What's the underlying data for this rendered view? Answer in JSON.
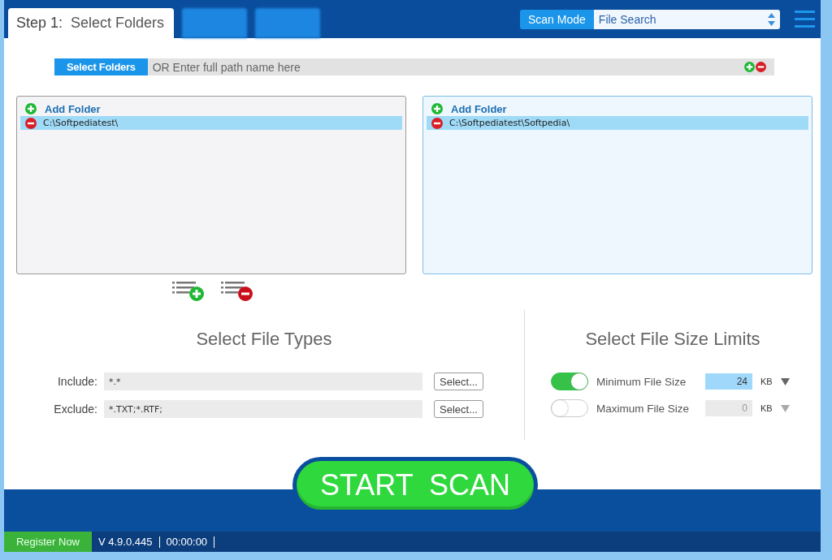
{
  "tabs": [
    {
      "label": "Step 1:",
      "title": "Select Folders",
      "selected": true
    },
    {
      "selected": false
    },
    {
      "selected": false
    }
  ],
  "scan_mode": {
    "label": "Scan Mode",
    "value": "File Search"
  },
  "path_bar": {
    "button": "Select Folders",
    "placeholder": "OR Enter full path name here"
  },
  "folder_panels": [
    {
      "focused": false,
      "add_label": "Add Folder",
      "folders": [
        {
          "path": "C:\\Softpediatest\\",
          "selected": true
        }
      ]
    },
    {
      "focused": true,
      "add_label": "Add Folder",
      "folders": [
        {
          "path": "C:\\Softpediatest\\Softpedia\\",
          "selected": true
        }
      ]
    }
  ],
  "file_types": {
    "title": "Select File Types",
    "rows": [
      {
        "label": "Include:",
        "value": "*.*",
        "button": "Select..."
      },
      {
        "label": "Exclude:",
        "value": "*.TXT;*.RTF;",
        "button": "Select..."
      }
    ]
  },
  "size_limits": {
    "title": "Select File Size Limits",
    "rows": [
      {
        "on": true,
        "label": "Minimum File Size",
        "value": "24",
        "unit": "KB"
      },
      {
        "on": false,
        "label": "Maximum File Size",
        "value": "0",
        "unit": "KB"
      }
    ]
  },
  "start_button": "START  SCAN",
  "status_bar": {
    "register": "Register Now",
    "version": "V 4.9.0.445",
    "time": "00:00:00"
  }
}
